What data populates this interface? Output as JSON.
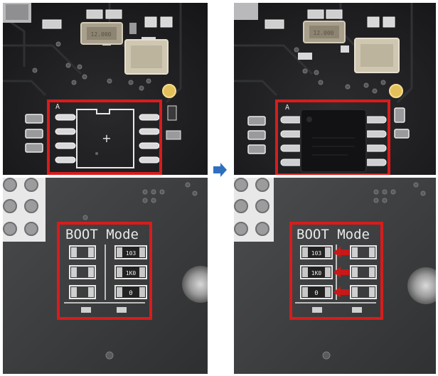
{
  "panels": {
    "top_before": {
      "pin1_marker": "A",
      "chip_silkscreen_mark": "+",
      "crystal_marking": "12.000"
    },
    "top_after": {
      "pin1_marker": "A",
      "crystal_marking": "12.000"
    },
    "bottom_before": {
      "silkscreen_label": "BOOT Mode",
      "resistor_markings": [
        "103",
        "1K0",
        "0"
      ]
    },
    "bottom_after": {
      "silkscreen_label": "BOOT Mode",
      "resistor_markings": [
        "103",
        "1K0",
        "0"
      ]
    }
  },
  "transition_icon": "arrow-right-icon",
  "colors": {
    "highlight_box": "#d81c1c",
    "annotation_arrow": "#c81818",
    "transition_arrow": "#2f6fc0",
    "pcb_dark": "#202023",
    "pcb_grey": "#3a3b3d",
    "silkscreen": "#e8e8e8"
  }
}
